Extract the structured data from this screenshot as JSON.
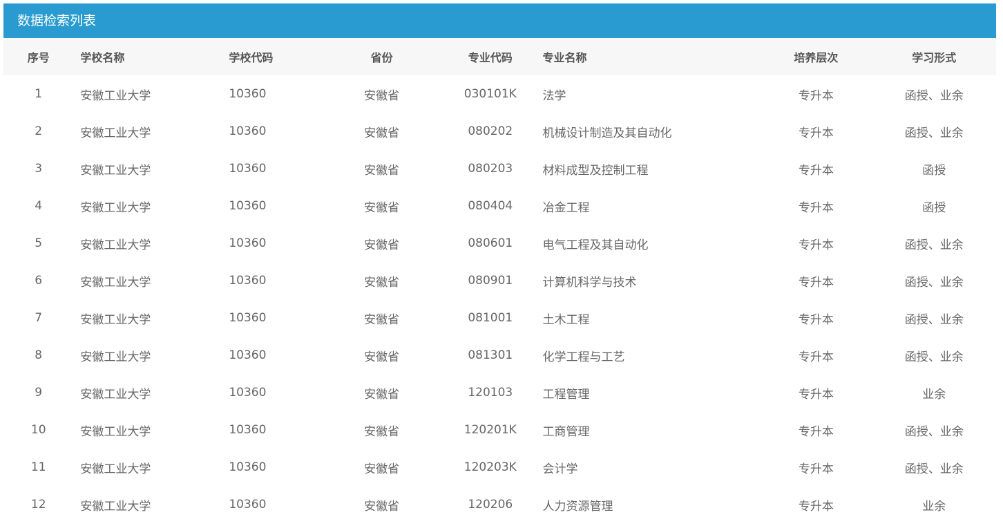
{
  "panel": {
    "title": "数据检索列表"
  },
  "columns": {
    "idx": "序号",
    "school": "学校名称",
    "school_code": "学校代码",
    "province": "省份",
    "major_code": "专业代码",
    "major": "专业名称",
    "level": "培养层次",
    "mode": "学习形式"
  },
  "rows": [
    {
      "idx": "1",
      "school": "安徽工业大学",
      "school_code": "10360",
      "province": "安徽省",
      "major_code": "030101K",
      "major": "法学",
      "level": "专升本",
      "mode": "函授、业余"
    },
    {
      "idx": "2",
      "school": "安徽工业大学",
      "school_code": "10360",
      "province": "安徽省",
      "major_code": "080202",
      "major": "机械设计制造及其自动化",
      "level": "专升本",
      "mode": "函授、业余"
    },
    {
      "idx": "3",
      "school": "安徽工业大学",
      "school_code": "10360",
      "province": "安徽省",
      "major_code": "080203",
      "major": "材料成型及控制工程",
      "level": "专升本",
      "mode": "函授"
    },
    {
      "idx": "4",
      "school": "安徽工业大学",
      "school_code": "10360",
      "province": "安徽省",
      "major_code": "080404",
      "major": "冶金工程",
      "level": "专升本",
      "mode": "函授"
    },
    {
      "idx": "5",
      "school": "安徽工业大学",
      "school_code": "10360",
      "province": "安徽省",
      "major_code": "080601",
      "major": "电气工程及其自动化",
      "level": "专升本",
      "mode": "函授、业余"
    },
    {
      "idx": "6",
      "school": "安徽工业大学",
      "school_code": "10360",
      "province": "安徽省",
      "major_code": "080901",
      "major": "计算机科学与技术",
      "level": "专升本",
      "mode": "函授、业余"
    },
    {
      "idx": "7",
      "school": "安徽工业大学",
      "school_code": "10360",
      "province": "安徽省",
      "major_code": "081001",
      "major": "土木工程",
      "level": "专升本",
      "mode": "函授、业余"
    },
    {
      "idx": "8",
      "school": "安徽工业大学",
      "school_code": "10360",
      "province": "安徽省",
      "major_code": "081301",
      "major": "化学工程与工艺",
      "level": "专升本",
      "mode": "函授、业余"
    },
    {
      "idx": "9",
      "school": "安徽工业大学",
      "school_code": "10360",
      "province": "安徽省",
      "major_code": "120103",
      "major": "工程管理",
      "level": "专升本",
      "mode": "业余"
    },
    {
      "idx": "10",
      "school": "安徽工业大学",
      "school_code": "10360",
      "province": "安徽省",
      "major_code": "120201K",
      "major": "工商管理",
      "level": "专升本",
      "mode": "函授、业余"
    },
    {
      "idx": "11",
      "school": "安徽工业大学",
      "school_code": "10360",
      "province": "安徽省",
      "major_code": "120203K",
      "major": "会计学",
      "level": "专升本",
      "mode": "函授、业余"
    },
    {
      "idx": "12",
      "school": "安徽工业大学",
      "school_code": "10360",
      "province": "安徽省",
      "major_code": "120206",
      "major": "人力资源管理",
      "level": "专升本",
      "mode": "业余"
    }
  ]
}
